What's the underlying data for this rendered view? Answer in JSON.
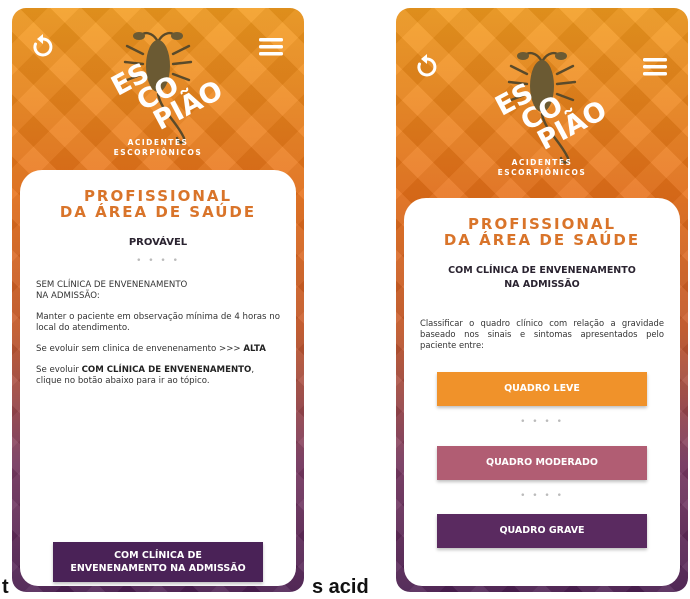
{
  "left": {
    "logo_lines": [
      "ES",
      "CO",
      "PIÃO"
    ],
    "logo_sub1": "ACIDENTES",
    "logo_sub2": "ESCORPIÔNICOS",
    "heading_line1": "PROFISSIONAL",
    "heading_line2": "DA ÁREA DE SAÚDE",
    "subtitle": "PROVÁVEL",
    "dots": "• • • •",
    "p1": "SEM CLÍNICA DE ENVENENAMENTO",
    "p1b": "NA ADMISSÃO:",
    "p2": "Manter o paciente em observação mínima de 4 horas no local do atendimento.",
    "p3_prefix": "Se evoluir sem clinica de envenenamento  >>> ",
    "p3_bold": "ALTA",
    "p4_prefix": "Se evoluir ",
    "p4_bold": "COM CLÍNICA DE ENVENENAMENTO",
    "p4_suffix": ", clique no botão abaixo para ir ao tópico.",
    "button_line1": "COM CLÍNICA DE",
    "button_line2": "ENVENENAMENTO NA ADMISSÃO"
  },
  "right": {
    "logo_lines": [
      "ES",
      "CO",
      "PIÃO"
    ],
    "logo_sub1": "ACIDENTES",
    "logo_sub2": "ESCORPIÔNICOS",
    "heading_line1": "PROFISSIONAL",
    "heading_line2": "DA ÁREA DE SAÚDE",
    "subtitle_line1": "COM CLÍNICA DE ENVENENAMENTO",
    "subtitle_line2": "NA ADMISSÃO",
    "p1": "Classificar o quadro clínico com relação a gravidade baseado nos sinais e sintomas apresentados pelo paciente entre:",
    "btn_leve": "QUADRO LEVE",
    "btn_moderado": "QUADRO MODERADO",
    "btn_grave": "QUADRO GRAVE",
    "dots": "• • • •"
  },
  "caption": {
    "left": "t",
    "middle": "s acid"
  },
  "colors": {
    "orange": "#f0922a",
    "heading": "#d9742a",
    "moderado": "#b15d73",
    "grave": "#5a2a60"
  },
  "icons": [
    "refresh-icon",
    "menu-icon",
    "scorpion-icon"
  ]
}
